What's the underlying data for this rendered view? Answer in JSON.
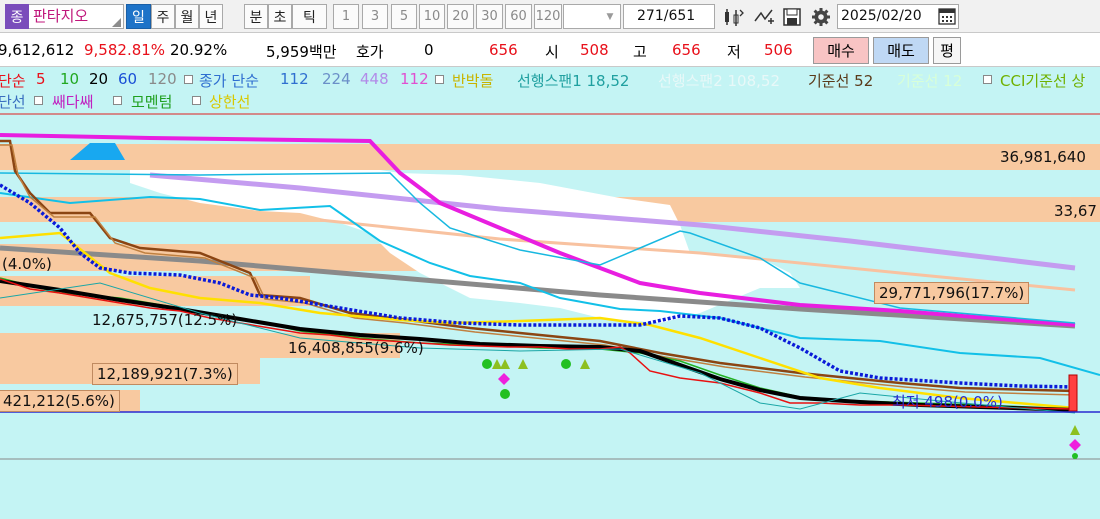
{
  "stock": {
    "badge": "종",
    "name": "판타지오"
  },
  "toolbar": {
    "periods": [
      "일",
      "주",
      "월",
      "년",
      "분",
      "초",
      "틱"
    ],
    "active_period": "일",
    "intervals": [
      "1",
      "3",
      "5",
      "10",
      "20",
      "30",
      "60",
      "120"
    ],
    "count_current": "271",
    "count_total": "/651",
    "date": "2025/02/20"
  },
  "price_row": {
    "volume": "9,612,612",
    "change_pct": "9,582.81%",
    "turnover": "20.92%",
    "amount": "5,959백만",
    "quote_label": "호가",
    "quote_value": "0",
    "current_price": "656",
    "open_label": "시",
    "open_value": "508",
    "high_label": "고",
    "high_value": "656",
    "low_label": "저",
    "low_value": "506",
    "buy_label": "매수",
    "sell_label": "매도",
    "avg_label": "평"
  },
  "legend": {
    "row1": [
      {
        "text": "단순",
        "color": "#e8101a"
      },
      {
        "text": "5",
        "color": "#e8101a"
      },
      {
        "text": "10",
        "color": "#21a821"
      },
      {
        "text": "20",
        "color": "#000000"
      },
      {
        "text": "60",
        "color": "#1a4fd6"
      },
      {
        "text": "120",
        "color": "#8a8a8a"
      },
      {
        "text": "종가 단순",
        "color": "#2f6fd0"
      },
      {
        "text": "112",
        "color": "#2f6fd0"
      },
      {
        "text": "224",
        "color": "#6b8fc8"
      },
      {
        "text": "448",
        "color": "#b28be8"
      },
      {
        "text": "112",
        "color": "#e050d0"
      },
      {
        "text": "반박돌",
        "color": "#c8b400"
      },
      {
        "text": "선행스팬1 18,52",
        "color": "#20a0a0"
      },
      {
        "text": "선행스팬2 108,52",
        "color": "#e8f8f8"
      },
      {
        "text": "기준선 52",
        "color": "#5a3a1a"
      },
      {
        "text": "기준선 12",
        "color": "#d8ffd8"
      },
      {
        "text": "CCI기준선 상",
        "color": "#70b000"
      }
    ],
    "row2": [
      {
        "text": "단선",
        "color": "#3a6fc0"
      },
      {
        "text": "쌔다쌔",
        "color": "#c020c0"
      },
      {
        "text": "모멘텀",
        "color": "#20a020"
      },
      {
        "text": "상한선",
        "color": "#d8c800"
      }
    ]
  },
  "price_labels": [
    "36,981,640",
    "33,67",
    "29,771,796(17.7%)",
    "(4.0%)",
    "12,675,757(12.5%)",
    "16,408,855(9.6%)",
    "12,189,921(7.3%)",
    "421,212(5.6%)",
    "최저 498(0.0%)"
  ],
  "colors": {
    "chart_bg": "#c4f4f4",
    "band": "#f8c9a0",
    "magenta": "#e81ee0",
    "lavender": "#c49cf0",
    "gray_ma": "#8a8a8a",
    "brown": "#8b4513",
    "blue_dots": "#0a1ad8",
    "cyan": "#12c0e8",
    "black_ma": "#000000",
    "yellow": "#ffe000",
    "green_marker": "#22c022",
    "pink_marker": "#ee22dd",
    "olive_marker": "#8dc020"
  }
}
